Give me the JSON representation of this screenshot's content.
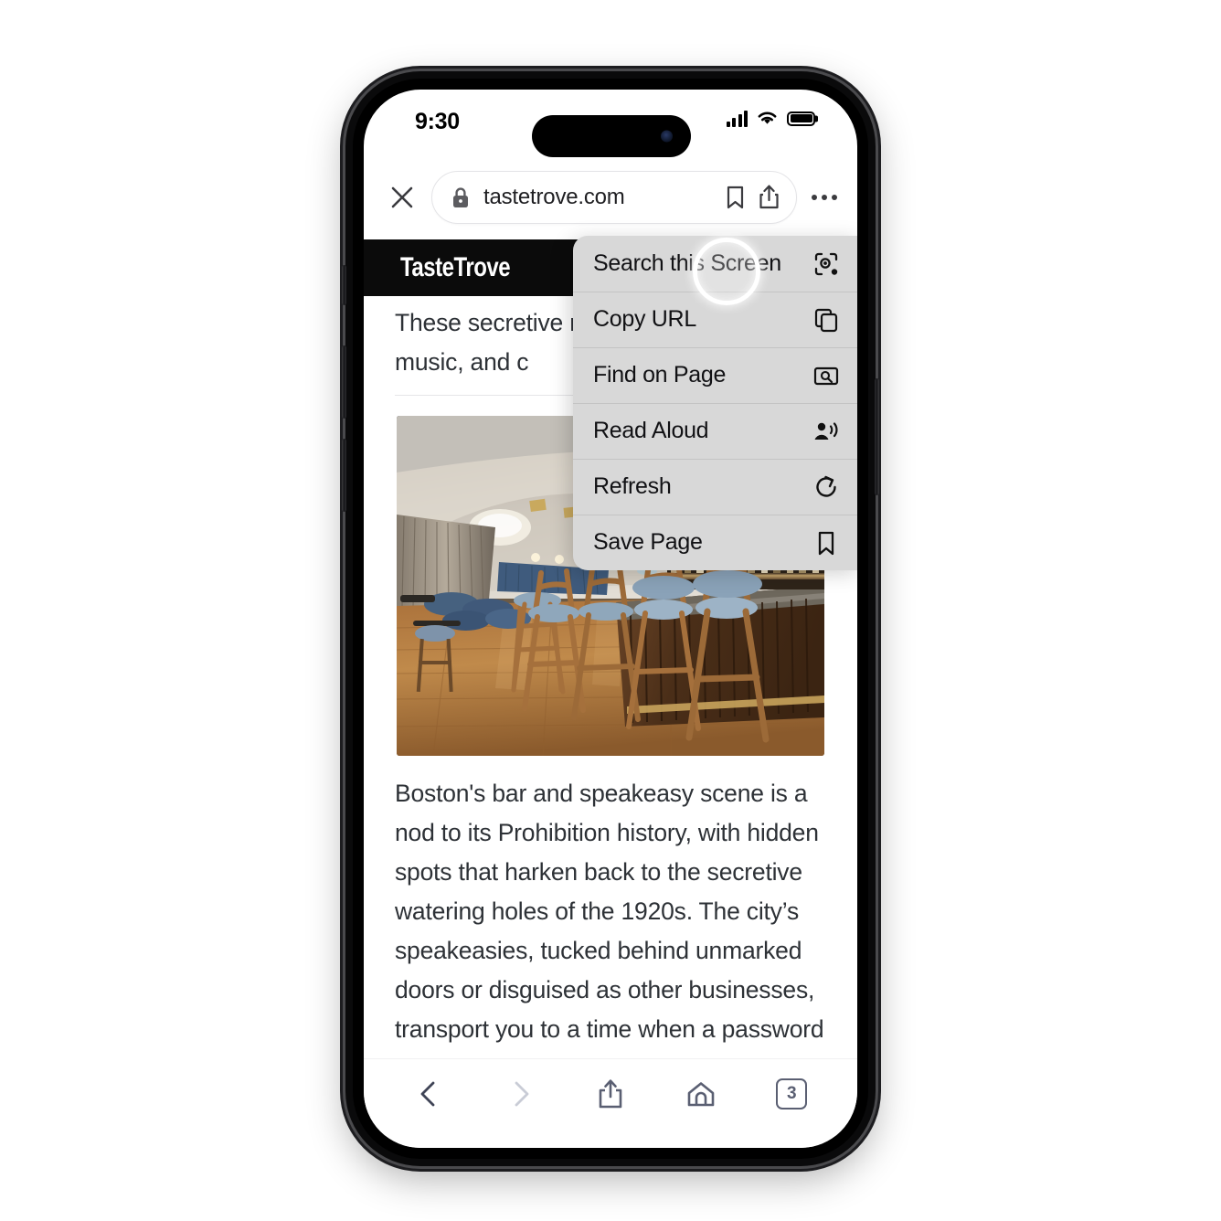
{
  "device": {
    "status_bar": {
      "time": "9:30",
      "cellular_icon": "cellular-bars-icon",
      "wifi_icon": "wifi-icon",
      "battery_icon": "battery-full-icon"
    },
    "hardware": {
      "action_button": "action-button",
      "volume_up": "volume-up-button",
      "volume_down": "volume-down-button",
      "power_button": "power-button"
    }
  },
  "browser": {
    "close_tab_icon": "close-icon",
    "url_bar": {
      "lock_icon": "lock-icon",
      "url": "tastetrove.com",
      "bookmark_icon": "bookmark-icon",
      "share_icon": "share-icon"
    },
    "overflow_icon": "more-options-icon",
    "bottom_toolbar": {
      "back_label": "Back",
      "forward_label": "Forward",
      "share_label": "Share",
      "home_label": "Home",
      "tab_count": "3"
    }
  },
  "webpage": {
    "site_name": "TasteTrove",
    "intro_paragraph": "These secretive nostalgic, vintag jazz music, and c",
    "photo_alt": "Interior of a dimly lit speakeasy bar with blue velvet bar stools, a wood-slat bar front, backlit bottle shelves and a chandelier",
    "body_paragraph": "Boston's bar and speakeasy scene is a nod to its Prohibition history, with hidden spots that harken back to the secretive watering holes of the 1920s. The city’s speakeasies, tucked behind unmarked doors or disguised as other businesses, transport you to a time when a password could be the difference"
  },
  "context_menu": {
    "items": [
      {
        "label": "Search this Screen",
        "icon": "google-lens-icon"
      },
      {
        "label": "Copy URL",
        "icon": "copy-icon"
      },
      {
        "label": "Find on Page",
        "icon": "find-in-page-icon"
      },
      {
        "label": "Read Aloud",
        "icon": "read-aloud-icon"
      },
      {
        "label": "Refresh",
        "icon": "refresh-icon"
      },
      {
        "label": "Save Page",
        "icon": "bookmark-icon"
      }
    ]
  },
  "interaction": {
    "tap_target": "Search this Screen"
  },
  "colors": {
    "menu_background": "#d8d8d8",
    "site_header_background": "#0b0b0b",
    "body_text": "#2d3136",
    "toolbar_icon": "#5a5f72"
  }
}
